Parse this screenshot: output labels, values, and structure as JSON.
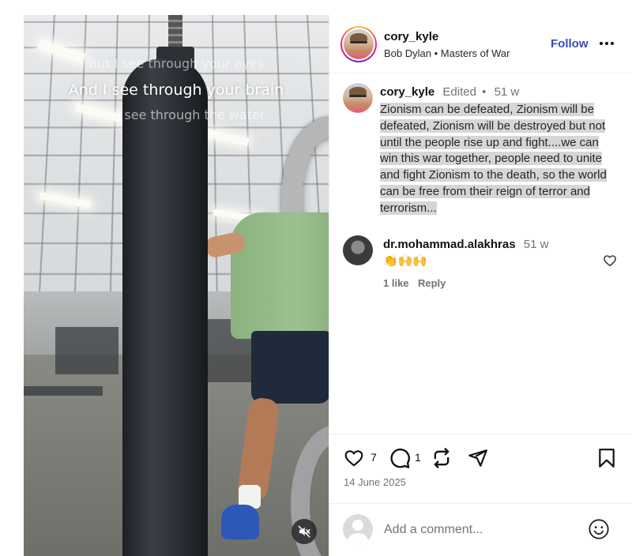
{
  "video": {
    "lyrics": [
      "But I see through your eyes",
      "And I see through your brain",
      "Like I see through the water"
    ]
  },
  "post_header": {
    "username": "cory_kyle",
    "audio_artist": "Bob Dylan",
    "audio_separator": "•",
    "audio_title": "Masters of War",
    "follow_label": "Follow"
  },
  "caption": {
    "username": "cory_kyle",
    "edited_label": "Edited",
    "separator": "•",
    "age": "51 w",
    "text": "Zionism can be defeated, Zionism will be defeated, Zionism will be destroyed but not until the people rise up and fight....we can win this war together, people need to unite and fight Zionism to the death, so the world can be free from their reign of terror and terrorism..."
  },
  "comment": {
    "username": "dr.mohammad.alakhras",
    "age": "51 w",
    "text": "👏🙌🙌",
    "likes_label": "1 like",
    "reply_label": "Reply"
  },
  "actions": {
    "like_count": "7",
    "comment_count": "1",
    "date": "14 June 2025"
  },
  "add_comment": {
    "placeholder": "Add a comment..."
  },
  "colors": {
    "follow_blue": "#3b4bb8",
    "muted_text": "#737373",
    "caption_highlight": "#d6d6d6"
  },
  "icons": [
    "mute-icon",
    "more-icon",
    "heart-icon",
    "comment-icon",
    "repost-icon",
    "share-icon",
    "bookmark-icon",
    "emoji-icon"
  ]
}
